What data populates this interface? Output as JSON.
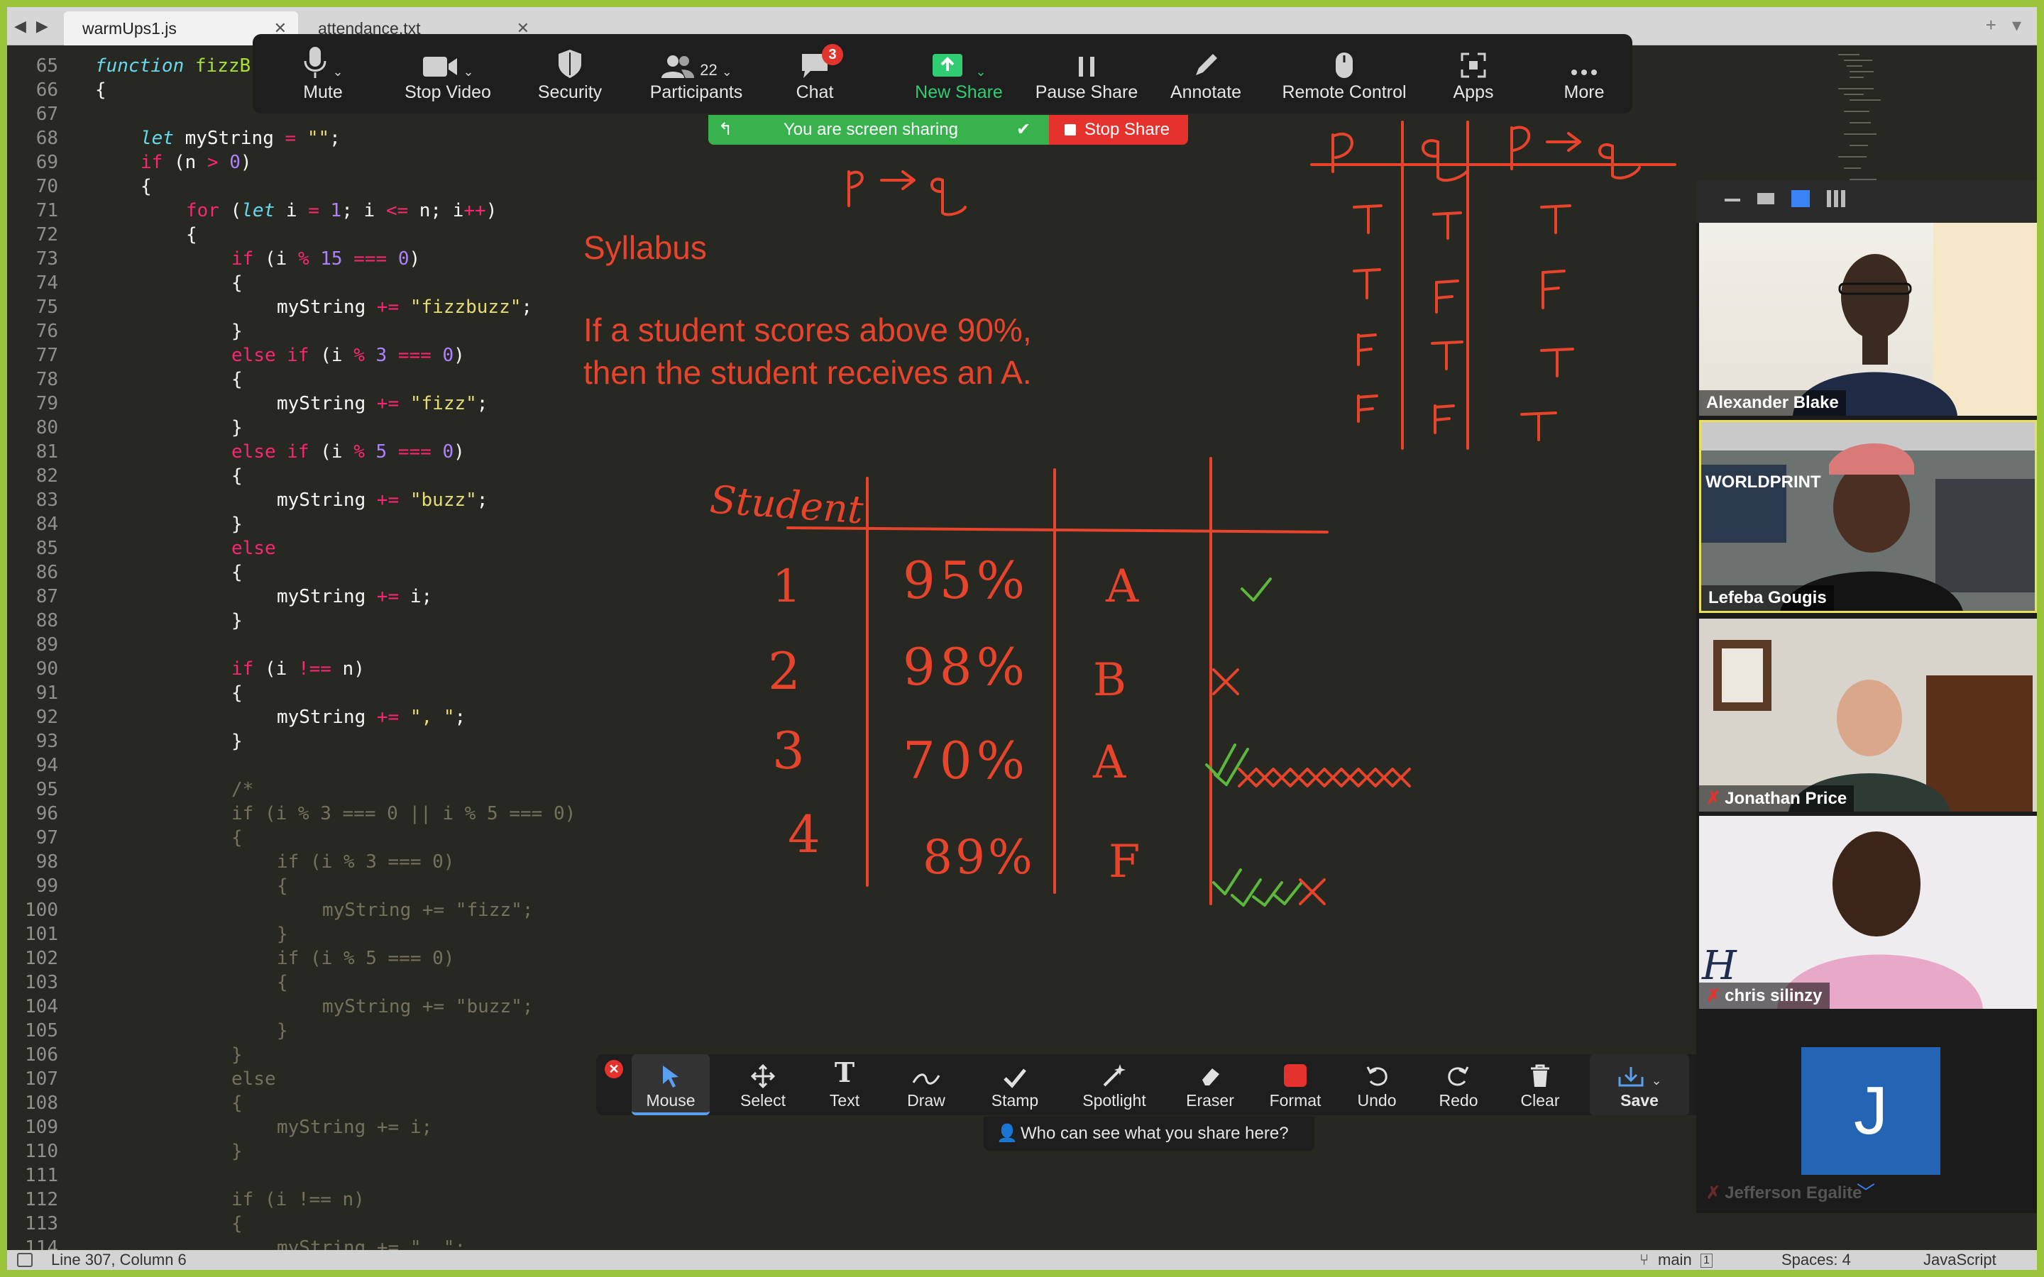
{
  "tabs": [
    {
      "label": "warmUps1.js",
      "active": true
    },
    {
      "label": "attendance.txt",
      "active": false
    }
  ],
  "editor": {
    "lines": [
      {
        "n": "65"
      },
      {
        "n": "66"
      },
      {
        "n": "67"
      },
      {
        "n": "68"
      },
      {
        "n": "69"
      },
      {
        "n": "70"
      },
      {
        "n": "71"
      },
      {
        "n": "72"
      },
      {
        "n": "73"
      },
      {
        "n": "74"
      },
      {
        "n": "75"
      },
      {
        "n": "76"
      },
      {
        "n": "77"
      },
      {
        "n": "78"
      },
      {
        "n": "79"
      },
      {
        "n": "80"
      },
      {
        "n": "81"
      },
      {
        "n": "82"
      },
      {
        "n": "83"
      },
      {
        "n": "84"
      },
      {
        "n": "85"
      },
      {
        "n": "86"
      },
      {
        "n": "87"
      },
      {
        "n": "88"
      },
      {
        "n": "89"
      },
      {
        "n": "90"
      },
      {
        "n": "91"
      },
      {
        "n": "92"
      },
      {
        "n": "93"
      },
      {
        "n": "94"
      },
      {
        "n": "95"
      },
      {
        "n": "96"
      },
      {
        "n": "97"
      },
      {
        "n": "98"
      },
      {
        "n": "99"
      },
      {
        "n": "100"
      },
      {
        "n": "101"
      },
      {
        "n": "102"
      },
      {
        "n": "103"
      },
      {
        "n": "104"
      },
      {
        "n": "105"
      },
      {
        "n": "106"
      },
      {
        "n": "107"
      },
      {
        "n": "108"
      },
      {
        "n": "109"
      },
      {
        "n": "110"
      },
      {
        "n": "111"
      },
      {
        "n": "112"
      },
      {
        "n": "113"
      },
      {
        "n": "114"
      }
    ],
    "code": {
      "l65_kw": "function",
      "l65_fn": " fizzB",
      "l66": "{",
      "l68_kw": "let",
      "l68_rest": " myString ",
      "l68_op": "=",
      "l68_str": " \"\"",
      "l68_end": ";",
      "l69_kw": "if",
      "l69_a": " (n ",
      "l69_op": ">",
      "l69_num": " 0",
      "l69_end": ")",
      "l70": "{",
      "l71_kw": "for",
      "l71_a": " (",
      "l71_let": "let",
      "l71_b": " i ",
      "l71_op1": "=",
      "l71_num": " 1",
      "l71_c": "; i ",
      "l71_op2": "<=",
      "l71_d": " n; i",
      "l71_op3": "++",
      "l71_e": ")",
      "l72": "{",
      "l73_kw": "if",
      "l73_a": " (i ",
      "l73_op": "%",
      "l73_num": " 15",
      "l73_op2": " ===",
      "l73_num2": " 0",
      "l73_e": ")",
      "l74": "{",
      "l75_a": "myString ",
      "l75_op": "+=",
      "l75_str": " \"fizzbuzz\"",
      "l75_e": ";",
      "l76": "}",
      "l77_kw": "else if",
      "l77_a": " (i ",
      "l77_op": "%",
      "l77_num": " 3",
      "l77_op2": " ===",
      "l77_num2": " 0",
      "l77_e": ")",
      "l78": "{",
      "l79_a": "myString ",
      "l79_op": "+=",
      "l79_str": " \"fizz\"",
      "l79_e": ";",
      "l80": "}",
      "l81_kw": "else if",
      "l81_a": " (i ",
      "l81_op": "%",
      "l81_num": " 5",
      "l81_op2": " ===",
      "l81_num2": " 0",
      "l81_e": ")",
      "l82": "{",
      "l83_a": "myString ",
      "l83_op": "+=",
      "l83_str": " \"buzz\"",
      "l83_e": ";",
      "l84": "}",
      "l85_kw": "else",
      "l86": "{",
      "l87_a": "myString ",
      "l87_op": "+=",
      "l87_e": " i;",
      "l88": "}",
      "l90_kw": "if",
      "l90_a": " (i ",
      "l90_op": "!==",
      "l90_e": " n)",
      "l91": "{",
      "l92_a": "myString ",
      "l92_op": "+=",
      "l92_str": " \", \"",
      "l92_e": ";",
      "l93": "}",
      "l95": "/*",
      "l96": "if (i % 3 === 0 || i % 5 === 0)",
      "l97": "{",
      "l98": "if (i % 3 === 0)",
      "l99": "{",
      "l100": "myString += \"fizz\";",
      "l101": "}",
      "l102": "if (i % 5 === 0)",
      "l103": "{",
      "l104": "myString += \"buzz\";",
      "l105": "}",
      "l106": "}",
      "l107": "else",
      "l108": "{",
      "l109": "myString += i;",
      "l110": "}",
      "l112": "if (i !== n)",
      "l113": "{",
      "l114": "myString += \", \";"
    }
  },
  "statusbar": {
    "position": "Line 307, Column 6",
    "branch": "main",
    "branch_count": "1",
    "spaces": "Spaces: 4",
    "syntax": "JavaScript"
  },
  "zoom_toolbar": {
    "mute": "Mute",
    "stop_video": "Stop Video",
    "security": "Security",
    "participants": "Participants",
    "participants_count": "22",
    "chat": "Chat",
    "chat_badge": "3",
    "new_share": "New Share",
    "pause_share": "Pause Share",
    "annotate": "Annotate",
    "remote_control": "Remote Control",
    "apps": "Apps",
    "more": "More"
  },
  "sharing": {
    "status": "You are screen sharing",
    "stop": "Stop Share"
  },
  "annotations": {
    "syllabus_title": "Syllabus",
    "syllabus_line1": "If a student scores above 90%,",
    "syllabus_line2": "then the student receives an A.",
    "implication": "p → q",
    "truth_table_header": [
      "p",
      "q",
      "p → q"
    ],
    "truth_table_rows": [
      [
        "T",
        "T",
        "T"
      ],
      [
        "T",
        "F",
        "F"
      ],
      [
        "F",
        "T",
        "T"
      ],
      [
        "F",
        "F",
        "T"
      ]
    ],
    "student_header": "Student",
    "students": [
      {
        "id": "1",
        "score": "95%",
        "grade": "A",
        "mark": "check"
      },
      {
        "id": "2",
        "score": "98%",
        "grade": "B",
        "mark": "cross"
      },
      {
        "id": "3",
        "score": "70%",
        "grade": "A",
        "mark": "mixed"
      },
      {
        "id": "4",
        "score": "89%",
        "grade": "F",
        "mark": "mixed"
      }
    ],
    "ink_color": "#e8442c",
    "check_color": "#5cb83c"
  },
  "annotate_toolbar": {
    "mouse": "Mouse",
    "select": "Select",
    "text": "Text",
    "draw": "Draw",
    "stamp": "Stamp",
    "spotlight": "Spotlight",
    "eraser": "Eraser",
    "format": "Format",
    "undo": "Undo",
    "redo": "Redo",
    "clear": "Clear",
    "save": "Save",
    "who_can_see": "Who can see what you share here?"
  },
  "participants": [
    {
      "name": "Alexander Blake",
      "muted": false
    },
    {
      "name": "Lefeba Gougis",
      "muted": false,
      "active_speaker": true
    },
    {
      "name": "Jonathan Price",
      "muted": true
    },
    {
      "name": "chris silinzy",
      "muted": true
    },
    {
      "name": "Jefferson Egalite",
      "muted": true,
      "avatar_letter": "J"
    }
  ],
  "colors": {
    "editor_bg": "#272822",
    "zoom_green": "#37b24d",
    "zoom_red": "#e5322d",
    "frame_green": "#9bc43c"
  }
}
